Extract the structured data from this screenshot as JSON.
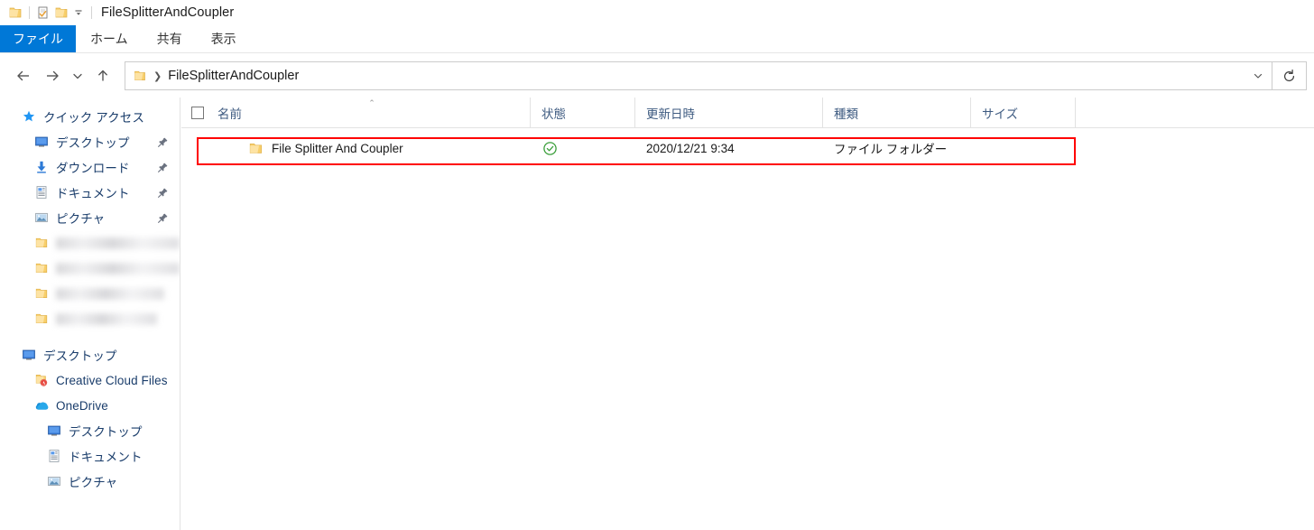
{
  "window": {
    "title": "FileSplitterAndCoupler",
    "quick_access_toolbar": [
      {
        "name": "folder-icon",
        "label": ""
      },
      {
        "name": "properties-icon",
        "label": ""
      },
      {
        "name": "new-folder-icon",
        "label": ""
      },
      {
        "name": "chevron-down-icon",
        "glyph": "⌄"
      }
    ]
  },
  "ribbon": {
    "tabs": [
      {
        "label": "ファイル",
        "active": true
      },
      {
        "label": "ホーム",
        "active": false
      },
      {
        "label": "共有",
        "active": false
      },
      {
        "label": "表示",
        "active": false
      }
    ]
  },
  "navbar": {
    "back_glyph": "←",
    "forward_glyph": "→",
    "recent_glyph": "⌄",
    "up_glyph": "↑",
    "breadcrumb_separator": "❯",
    "breadcrumb": "FileSplitterAndCoupler",
    "dropdown_glyph": "⌄",
    "refresh_glyph": "↻"
  },
  "sidebar": {
    "items": [
      {
        "label": "クイック アクセス",
        "icon": "star-icon",
        "level": 0,
        "pinned": false,
        "redacted": false
      },
      {
        "label": "デスクトップ",
        "icon": "desktop-icon",
        "level": 1,
        "pinned": true,
        "redacted": false
      },
      {
        "label": "ダウンロード",
        "icon": "download-icon",
        "level": 1,
        "pinned": true,
        "redacted": false
      },
      {
        "label": "ドキュメント",
        "icon": "document-icon",
        "level": 1,
        "pinned": true,
        "redacted": false
      },
      {
        "label": "ピクチャ",
        "icon": "pictures-icon",
        "level": 1,
        "pinned": true,
        "redacted": false
      },
      {
        "label": "",
        "icon": "folder-icon",
        "level": 1,
        "pinned": false,
        "redacted": true,
        "blur_width": 150
      },
      {
        "label": "",
        "icon": "folder-icon",
        "level": 1,
        "pinned": false,
        "redacted": true,
        "blur_width": 152
      },
      {
        "label": "",
        "icon": "folder-icon",
        "level": 1,
        "pinned": false,
        "redacted": true,
        "blur_width": 120
      },
      {
        "label": "",
        "icon": "folder-icon",
        "level": 1,
        "pinned": false,
        "redacted": true,
        "blur_width": 112
      },
      {
        "label": "デスクトップ",
        "icon": "desktop-icon",
        "level": 0,
        "pinned": false,
        "redacted": false
      },
      {
        "label": "Creative Cloud Files",
        "icon": "creative-cloud-folder-icon",
        "level": 1,
        "pinned": false,
        "redacted": false
      },
      {
        "label": "OneDrive",
        "icon": "onedrive-icon",
        "level": 1,
        "pinned": false,
        "redacted": false
      },
      {
        "label": "デスクトップ",
        "icon": "desktop-icon",
        "level": 2,
        "pinned": false,
        "redacted": false
      },
      {
        "label": "ドキュメント",
        "icon": "document-icon",
        "level": 2,
        "pinned": false,
        "redacted": false
      },
      {
        "label": "ピクチャ",
        "icon": "pictures-icon",
        "level": 2,
        "pinned": false,
        "redacted": false
      }
    ]
  },
  "filelist": {
    "columns": {
      "name": "名前",
      "state": "状態",
      "date": "更新日時",
      "type": "種類",
      "size": "サイズ"
    },
    "sort_caret": "⌃",
    "rows": [
      {
        "name": "File Splitter And Coupler",
        "state_icon": "sync-complete-icon",
        "date": "2020/12/21 9:34",
        "type": "ファイル フォルダー",
        "size": ""
      }
    ]
  },
  "annotation": {
    "type": "rectangle",
    "color": "#ff0000"
  },
  "colors": {
    "accent": "#0078d7",
    "folder_yellow": "#ffd271",
    "sync_green": "#3a9e3a",
    "nav_text": "#1a3d6b",
    "header_text": "#3d5a80",
    "annotation_red": "#ff0000"
  }
}
